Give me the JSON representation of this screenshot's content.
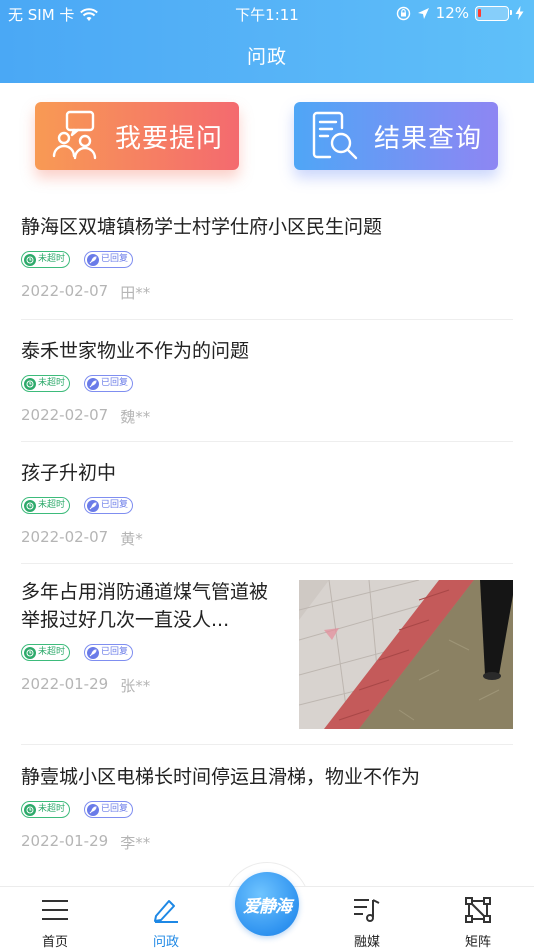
{
  "status_bar": {
    "carrier": "无 SIM 卡",
    "time": "下午1:11",
    "battery_percent": "12%",
    "battery_level": 0.12
  },
  "header": {
    "title": "问政"
  },
  "actions": {
    "ask_label": "我要提问",
    "query_label": "结果查询"
  },
  "list": [
    {
      "title": "静海区双塘镇杨学士村学仕府小区民生问题",
      "tag_time": "未超时",
      "tag_reply": "已回复",
      "date": "2022-02-07",
      "user": "田**"
    },
    {
      "title": "泰禾世家物业不作为的问题",
      "tag_time": "未超时",
      "tag_reply": "已回复",
      "date": "2022-02-07",
      "user": "魏**"
    },
    {
      "title": "孩子升初中",
      "tag_time": "未超时",
      "tag_reply": "已回复",
      "date": "2022-02-07",
      "user": "黄*"
    },
    {
      "title": "多年占用消防通道煤气管道被举报过好几次一直没人...",
      "tag_time": "未超时",
      "tag_reply": "已回复",
      "date": "2022-01-29",
      "user": "张**"
    },
    {
      "title": "静壹城小区电梯长时间停运且滑梯，物业不作为",
      "tag_time": "未超时",
      "tag_reply": "已回复",
      "date": "2022-01-29",
      "user": "李**"
    }
  ],
  "tabbar": {
    "home": "首页",
    "wenzheng": "问政",
    "center": "爱静海",
    "media": "融媒",
    "matrix": "矩阵"
  },
  "colors": {
    "header": "#56b3f7",
    "ask_button": "#f46a6f",
    "query_button": "#8e86f3",
    "active_tab": "#1e88e5",
    "tag_green": "#2eaa6b",
    "tag_blue": "#6a7be8"
  }
}
